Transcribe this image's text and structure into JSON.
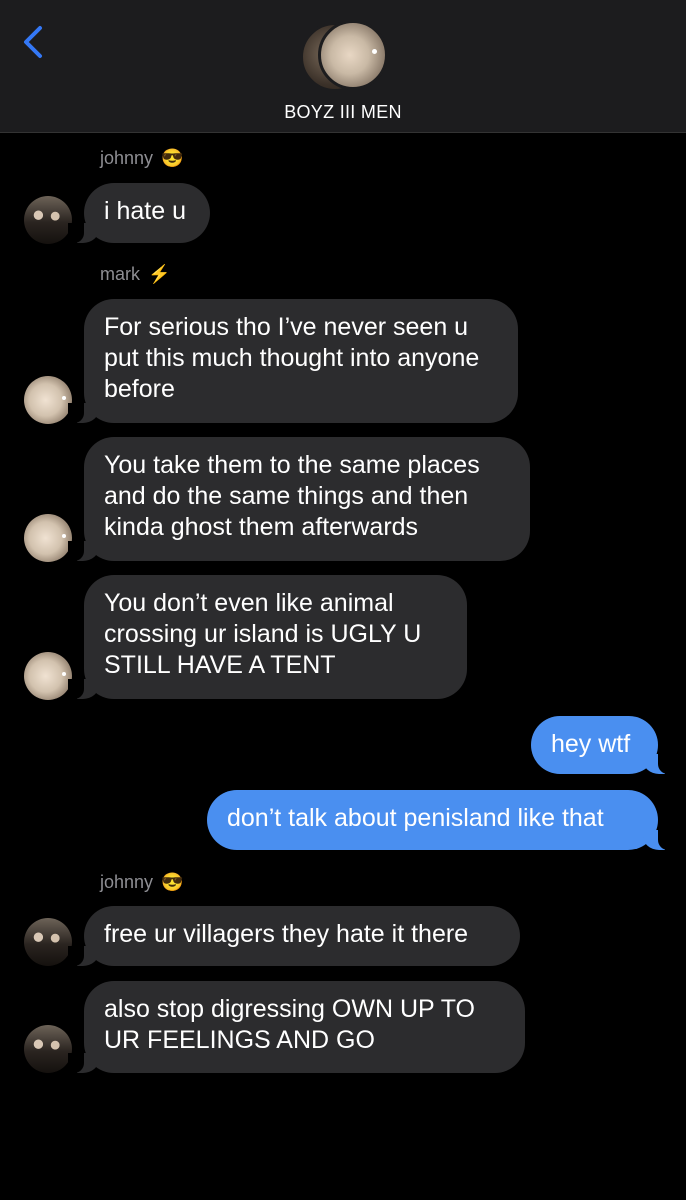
{
  "header": {
    "title": "BOYZ III MEN"
  },
  "messages": [
    {
      "sender": "johnny",
      "sender_emoji": "😎",
      "text": "i hate u"
    },
    {
      "sender": "mark",
      "sender_emoji": "⚡",
      "text": "For serious tho I’ve never seen u put this much thought into anyone before"
    },
    {
      "text": "You take them to the same places and do the same things and then kinda ghost them afterwards"
    },
    {
      "text": "You don’t even like animal crossing ur island is UGLY U STILL HAVE A TENT"
    },
    {
      "text": "hey wtf"
    },
    {
      "text": "don’t talk about penisland like that"
    },
    {
      "sender": "johnny",
      "sender_emoji": "😎",
      "text": "free ur villagers they hate it there"
    },
    {
      "text": "also stop digressing OWN UP TO UR FEELINGS AND GO"
    }
  ],
  "colors": {
    "incoming_bubble": "#2c2c2e",
    "outgoing_bubble": "#4a8ff0",
    "accent": "#3478f6"
  }
}
